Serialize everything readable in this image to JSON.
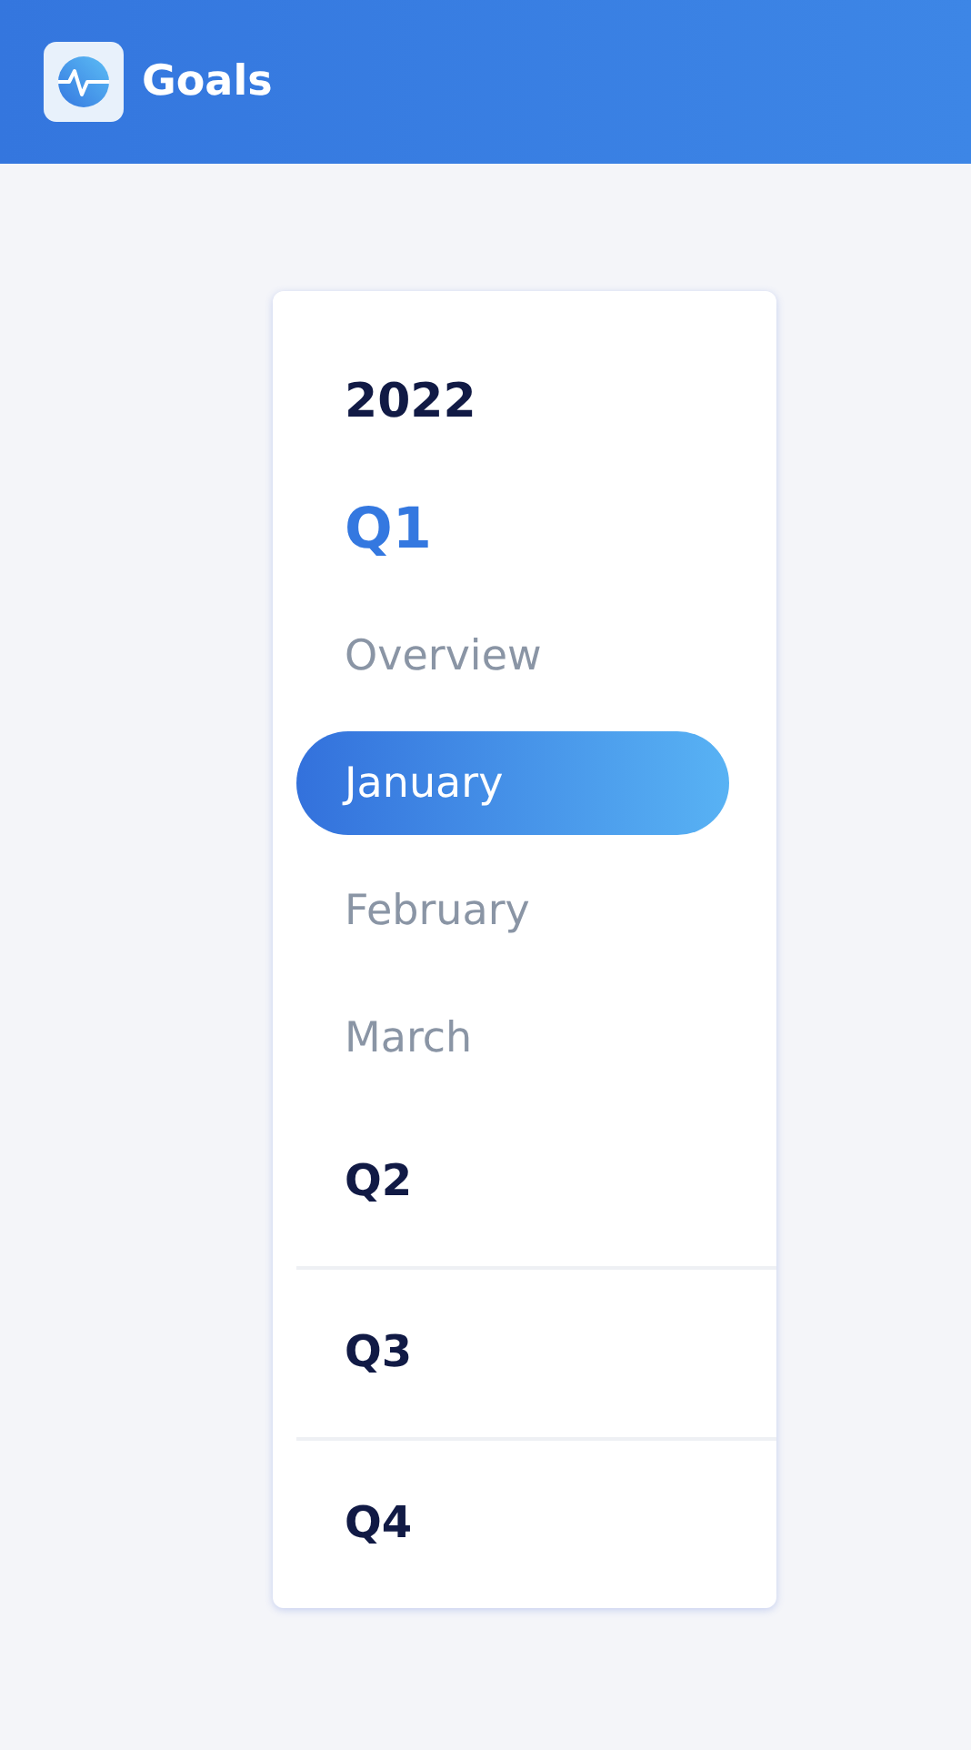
{
  "header": {
    "title": "Goals"
  },
  "year": "2022",
  "quarters": [
    {
      "label": "Q1",
      "expanded": true,
      "items": [
        {
          "label": "Overview",
          "selected": false
        },
        {
          "label": "January",
          "selected": true
        },
        {
          "label": "February",
          "selected": false
        },
        {
          "label": "March",
          "selected": false
        }
      ]
    },
    {
      "label": "Q2",
      "expanded": false
    },
    {
      "label": "Q3",
      "expanded": false
    },
    {
      "label": "Q4",
      "expanded": false
    }
  ]
}
